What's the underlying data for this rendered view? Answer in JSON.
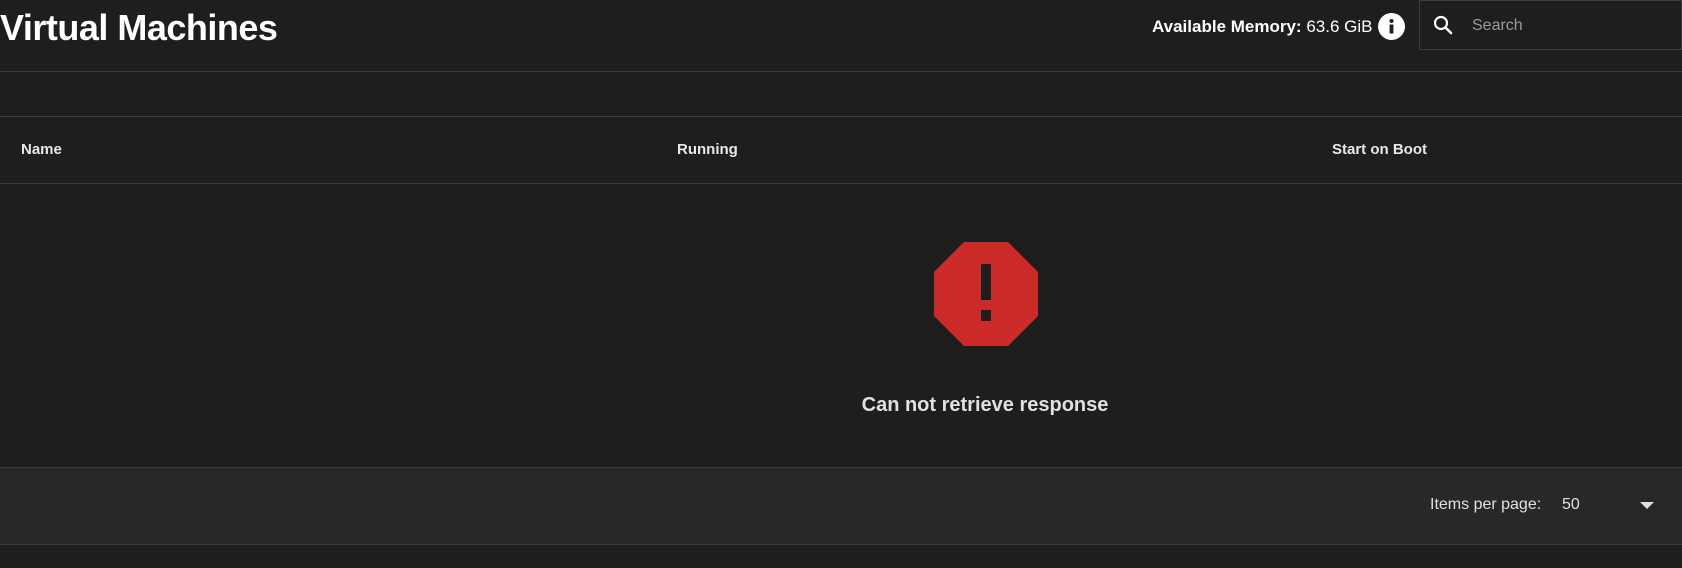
{
  "header": {
    "title": "Virtual Machines",
    "memory_label": "Available Memory:",
    "memory_value": "63.6 GiB",
    "info_icon": "info-icon"
  },
  "search": {
    "icon": "search-icon",
    "placeholder": "Search",
    "value": ""
  },
  "table": {
    "columns": [
      "Name",
      "Running",
      "Start on Boot"
    ]
  },
  "empty_state": {
    "icon": "error-octagon-icon",
    "icon_color": "#cc2929",
    "message": "Can not retrieve response"
  },
  "paginator": {
    "items_per_page_label": "Items per page:",
    "items_per_page_value": "50",
    "dropdown_icon": "chevron-down-icon"
  },
  "colors": {
    "background": "#1e1e1e",
    "paginator_background": "#282828",
    "divider": "#3a3a3a",
    "error": "#cc2929"
  }
}
